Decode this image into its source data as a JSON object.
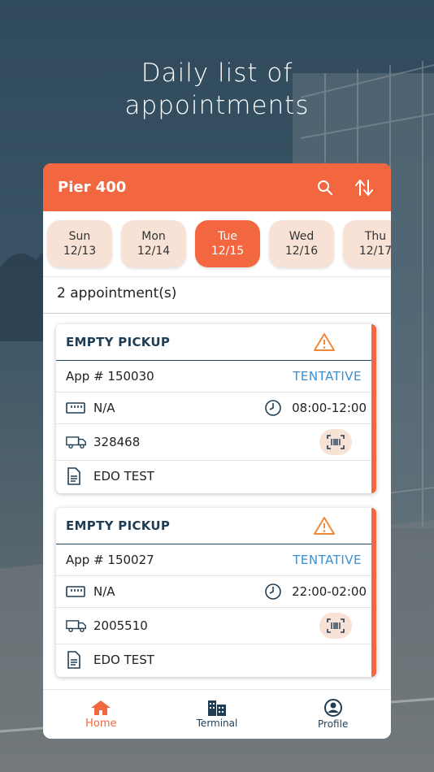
{
  "headline": {
    "line1": "Daily list of",
    "line2": "appointments"
  },
  "app": {
    "title": "Pier 400",
    "icons": {
      "search": "search-icon",
      "sort": "sort-icon"
    },
    "accent": "#f26640"
  },
  "dates": [
    {
      "day": "Sun",
      "date": "12/13",
      "active": false
    },
    {
      "day": "Mon",
      "date": "12/14",
      "active": false
    },
    {
      "day": "Tue",
      "date": "12/15",
      "active": true
    },
    {
      "day": "Wed",
      "date": "12/16",
      "active": false
    },
    {
      "day": "Thu",
      "date": "12/17",
      "active": false
    }
  ],
  "count_text": "2 appointment(s)",
  "appointments": [
    {
      "type": "EMPTY PICKUP",
      "app_no": "App # 150030",
      "status": "TENTATIVE",
      "container": "N/A",
      "time": "08:00-12:00",
      "truck": "328468",
      "doc": "EDO TEST"
    },
    {
      "type": "EMPTY PICKUP",
      "app_no": "App # 150027",
      "status": "TENTATIVE",
      "container": "N/A",
      "time": "22:00-02:00",
      "truck": "2005510",
      "doc": "EDO TEST"
    }
  ],
  "nav": [
    {
      "label": "Home",
      "icon": "home-icon",
      "active": true
    },
    {
      "label": "Terminal",
      "icon": "building-icon",
      "active": false
    },
    {
      "label": "Profile",
      "icon": "profile-icon",
      "active": false
    }
  ]
}
